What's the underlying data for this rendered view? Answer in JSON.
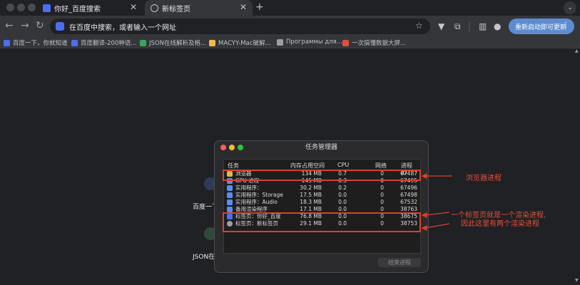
{
  "tabs": [
    {
      "title": "你好_百度搜索",
      "active": false
    },
    {
      "title": "新标签页",
      "active": true
    }
  ],
  "toolbar": {
    "address": "在百度中搜索，或者输入一个网址",
    "update_label": "重新启动即可更新"
  },
  "bookmarks": [
    {
      "label": "百度一下，你就知道",
      "icon": "baidu-icon",
      "color": "#4e6ef2"
    },
    {
      "label": "百度翻译-200种语...",
      "icon": "translate-icon",
      "color": "#4e6ef2"
    },
    {
      "label": "JSON在线解析及格...",
      "icon": "json-icon",
      "color": "#3aa757"
    },
    {
      "label": "MACYY-Mac破解...",
      "icon": "macyy-icon",
      "color": "#f2b84b"
    },
    {
      "label": "Программы для...",
      "icon": "programs-icon",
      "color": "#9aa0a6"
    },
    {
      "label": "一次搞懂数据大屏...",
      "icon": "c-icon",
      "color": "#e0503c"
    }
  ],
  "background_shortcuts": [
    {
      "label": "百度一下"
    },
    {
      "label": "JSON在"
    }
  ],
  "task_manager": {
    "title": "任务管理器",
    "columns": [
      "任务",
      "内存占用空间",
      "CPU",
      "网络",
      "进程 ID"
    ],
    "rows": [
      {
        "task": "浏览器",
        "memory": "134 MB",
        "cpu": "0.7",
        "network": "0",
        "pid": "67487",
        "icon": "chrome-icon"
      },
      {
        "task": "GPU 进程",
        "memory": "145 MB",
        "cpu": "0.3",
        "network": "0",
        "pid": "67495",
        "icon": "puzzle-icon"
      },
      {
        "task": "实用程序：",
        "memory": "30.2 MB",
        "cpu": "0.2",
        "network": "0",
        "pid": "67496",
        "icon": "puzzle-icon"
      },
      {
        "task": "实用程序：Storage",
        "memory": "17.5 MB",
        "cpu": "0.0",
        "network": "0",
        "pid": "67498",
        "icon": "puzzle-icon"
      },
      {
        "task": "实用程序：Audio",
        "memory": "18.3 MB",
        "cpu": "0.0",
        "network": "0",
        "pid": "67532",
        "icon": "puzzle-icon"
      },
      {
        "task": "备用渲染程序",
        "memory": "17.1 MB",
        "cpu": "0.0",
        "network": "0",
        "pid": "38763",
        "icon": "puzzle-icon"
      },
      {
        "task": "标签页：你好_百度",
        "memory": "76.8 MB",
        "cpu": "0.0",
        "network": "0",
        "pid": "38675",
        "icon": "baidu-icon"
      },
      {
        "task": "标签页：新标签页",
        "memory": "29.1 MB",
        "cpu": "0.0",
        "network": "0",
        "pid": "38753",
        "icon": "globe-icon"
      }
    ],
    "end_process_label": "结束进程"
  },
  "annotations": {
    "browser_process": "浏览器进程",
    "render_line1": "一个标签页就是一个渲染进程,",
    "render_line2": "因此这里有两个渲染进程"
  },
  "colors": {
    "annotation_red": "#d8412f",
    "update_button": "#5d8dd0"
  }
}
